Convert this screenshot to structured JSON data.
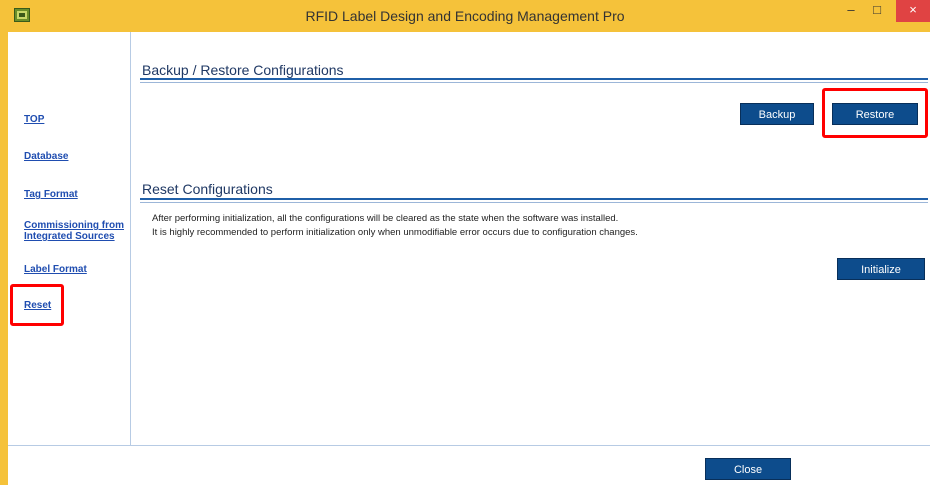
{
  "window": {
    "title": "RFID Label Design and Encoding Management Pro",
    "minimize_glyph": "–",
    "maximize_glyph": "□",
    "close_glyph": "×"
  },
  "sidebar": {
    "items": [
      {
        "label": "TOP"
      },
      {
        "label": "Database"
      },
      {
        "label": "Tag Format"
      },
      {
        "label_line1": "Commissioning from",
        "label_line2": "Integrated Sources"
      },
      {
        "label": "Label Format"
      },
      {
        "label": "Reset"
      }
    ]
  },
  "backup": {
    "title": "Backup / Restore Configurations",
    "backup_label": "Backup",
    "restore_label": "Restore"
  },
  "reset": {
    "title": "Reset Configurations",
    "desc1": "After performing initialization, all the configurations will be cleared as the state when the software was installed.",
    "desc2": "It is highly recommended to perform initialization only when unmodifiable error occurs due to configuration changes.",
    "initialize_label": "Initialize"
  },
  "footer": {
    "close_label": "Close"
  },
  "colors": {
    "frame": "#f5c23a",
    "button": "#0d4c8c",
    "link": "#1f4db0",
    "highlight": "#ff0000"
  }
}
